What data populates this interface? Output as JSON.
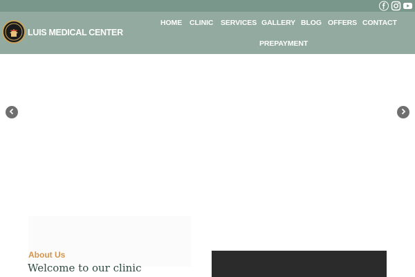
{
  "topbar": {
    "social_icons": [
      "facebook-icon",
      "instagram-icon",
      "youtube-icon"
    ]
  },
  "header": {
    "brand": "LUIS MEDICAL CENTER",
    "logo_icon": "clinic-logo",
    "nav": [
      "HOME",
      "CLINIC",
      "SERVICES",
      "GALLERY",
      "BLOG",
      "OFFERS",
      "CONTACT",
      "PREPAYMENT"
    ]
  },
  "slider": {
    "prev_icon": "chevron-left-icon",
    "next_icon": "chevron-right-icon"
  },
  "about": {
    "label": "About Us",
    "title": "Welcome to our clinic"
  },
  "colors": {
    "topbar": "#7a978b",
    "header": "#92aa9f",
    "accent": "#d4944b",
    "heading": "#2f4a40",
    "dark_panel": "#2b2b2b"
  }
}
